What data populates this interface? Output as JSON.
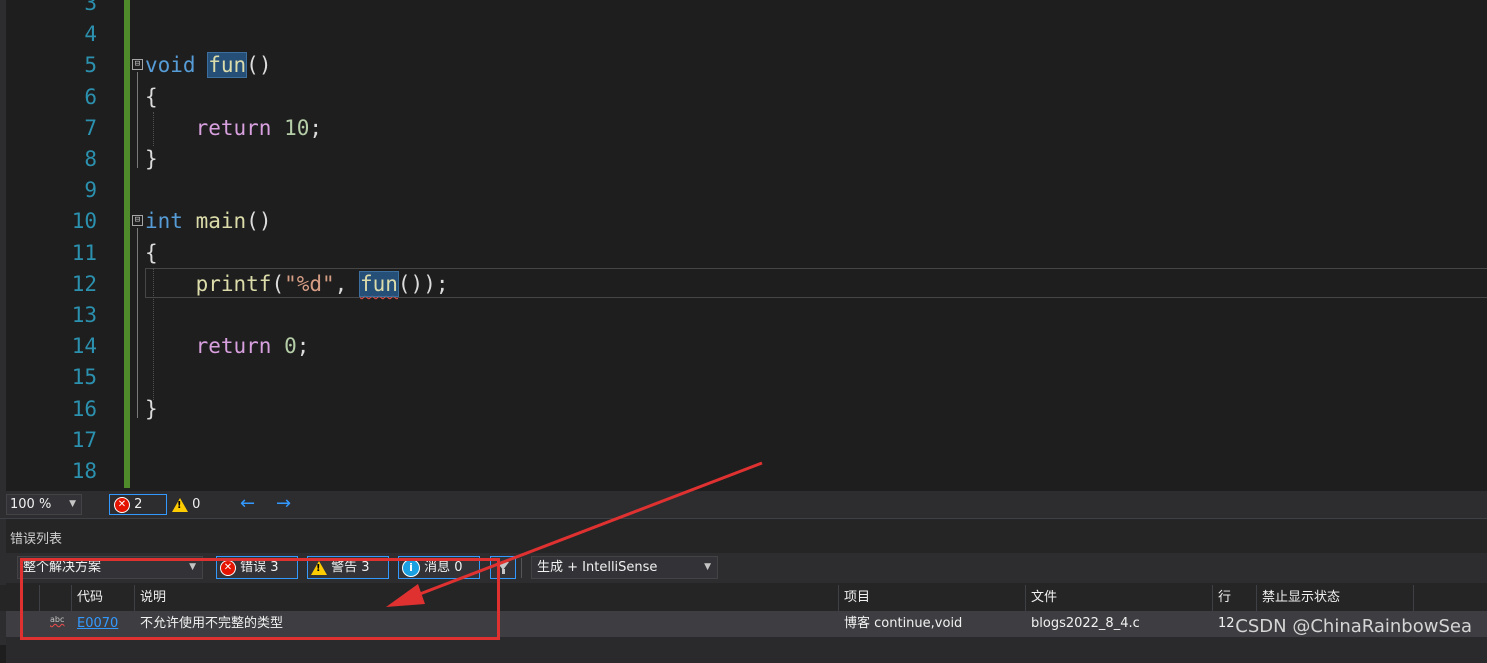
{
  "editor": {
    "lines": [
      {
        "num": "3",
        "tokens": []
      },
      {
        "num": "4",
        "tokens": []
      },
      {
        "num": "5",
        "tokens": [
          {
            "t": "void",
            "c": "tok-kw"
          },
          {
            "t": " ",
            "c": ""
          },
          {
            "t": "fun",
            "c": "tok-fn tok-hl"
          },
          {
            "t": "()",
            "c": ""
          }
        ]
      },
      {
        "num": "6",
        "tokens": [
          {
            "t": "{",
            "c": ""
          }
        ]
      },
      {
        "num": "7",
        "tokens": [
          {
            "t": "    ",
            "c": ""
          },
          {
            "t": "return",
            "c": "tok-ctl"
          },
          {
            "t": " ",
            "c": ""
          },
          {
            "t": "10",
            "c": "tok-num"
          },
          {
            "t": ";",
            "c": ""
          }
        ]
      },
      {
        "num": "8",
        "tokens": [
          {
            "t": "}",
            "c": ""
          }
        ]
      },
      {
        "num": "9",
        "tokens": []
      },
      {
        "num": "10",
        "tokens": [
          {
            "t": "int",
            "c": "tok-kw"
          },
          {
            "t": " ",
            "c": ""
          },
          {
            "t": "main",
            "c": "tok-fn"
          },
          {
            "t": "()",
            "c": ""
          }
        ]
      },
      {
        "num": "11",
        "tokens": [
          {
            "t": "{",
            "c": ""
          }
        ]
      },
      {
        "num": "12",
        "tokens": [
          {
            "t": "    ",
            "c": ""
          },
          {
            "t": "printf",
            "c": "tok-fn"
          },
          {
            "t": "(",
            "c": ""
          },
          {
            "t": "\"%d\"",
            "c": "tok-str"
          },
          {
            "t": ", ",
            "c": ""
          },
          {
            "t": "fun",
            "c": "tok-fn tok-hl squiggle"
          },
          {
            "t": "());",
            "c": ""
          }
        ]
      },
      {
        "num": "13",
        "tokens": []
      },
      {
        "num": "14",
        "tokens": [
          {
            "t": "    ",
            "c": ""
          },
          {
            "t": "return",
            "c": "tok-ctl"
          },
          {
            "t": " ",
            "c": ""
          },
          {
            "t": "0",
            "c": "tok-num"
          },
          {
            "t": ";",
            "c": ""
          }
        ]
      },
      {
        "num": "15",
        "tokens": []
      },
      {
        "num": "16",
        "tokens": [
          {
            "t": "}",
            "c": ""
          }
        ]
      },
      {
        "num": "17",
        "tokens": []
      },
      {
        "num": "18",
        "tokens": []
      }
    ],
    "fold_marker": "⊟"
  },
  "status": {
    "zoom": "100 %",
    "errors": "2",
    "warnings": "0",
    "nav_back": "←",
    "nav_forward": "→"
  },
  "error_list": {
    "title": "错误列表",
    "scope": "整个解决方案",
    "errors_label": "错误 3",
    "warnings_label": "警告 3",
    "messages_label": "消息 0",
    "source": "生成 + IntelliSense",
    "columns": {
      "code": "代码",
      "description": "说明",
      "project": "项目",
      "file": "文件",
      "line": "行",
      "suppression": "禁止显示状态"
    },
    "rows": [
      {
        "icon": "abc",
        "code": "E0070",
        "description": "不允许使用不完整的类型",
        "project": "博客 continue,void",
        "file": "blogs2022_8_4.c",
        "line": "12"
      }
    ]
  },
  "watermark": "CSDN @ChinaRainbowSea",
  "colors": {
    "accent": "#3399ff",
    "error": "#e51400",
    "warning": "#ffcc00",
    "annotation": "#e03131",
    "change_bar": "#4f8a2b"
  }
}
